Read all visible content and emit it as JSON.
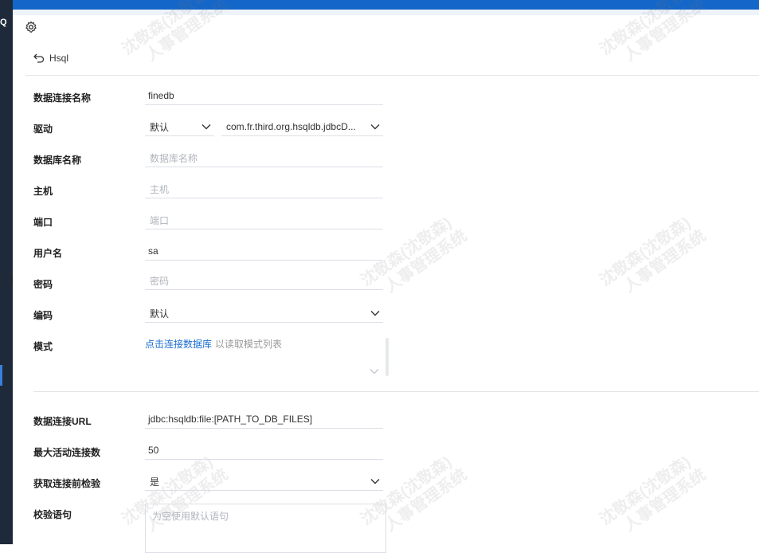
{
  "header": {
    "title": "Hsql"
  },
  "leftnav": {
    "badge": "Q"
  },
  "form": {
    "connection_name": {
      "label": "数据连接名称",
      "value": "finedb"
    },
    "driver": {
      "label": "驱动",
      "type_value": "默认",
      "class_value": "com.fr.third.org.hsqldb.jdbcD..."
    },
    "database_name": {
      "label": "数据库名称",
      "placeholder": "数据库名称"
    },
    "host": {
      "label": "主机",
      "placeholder": "主机"
    },
    "port": {
      "label": "端口",
      "placeholder": "端口"
    },
    "username": {
      "label": "用户名",
      "value": "sa"
    },
    "password": {
      "label": "密码",
      "placeholder": "密码"
    },
    "encoding": {
      "label": "编码",
      "value": "默认"
    },
    "schema": {
      "label": "模式",
      "link": "点击连接数据库",
      "hint": "以读取模式列表"
    },
    "url": {
      "label": "数据连接URL",
      "value": "jdbc:hsqldb:file:[PATH_TO_DB_FILES]"
    },
    "max_active": {
      "label": "最大活动连接数",
      "value": "50"
    },
    "validate_before": {
      "label": "获取连接前检验",
      "value": "是"
    },
    "validation_query": {
      "label": "校验语句",
      "placeholder": "为空使用默认语句"
    }
  },
  "watermark": {
    "line1": "沈敬森(沈敬森)",
    "line2": "人事管理系统"
  },
  "colors": {
    "topbar": "#1466c8",
    "link": "#1a6dd1",
    "nav": "#1e2a3a"
  }
}
